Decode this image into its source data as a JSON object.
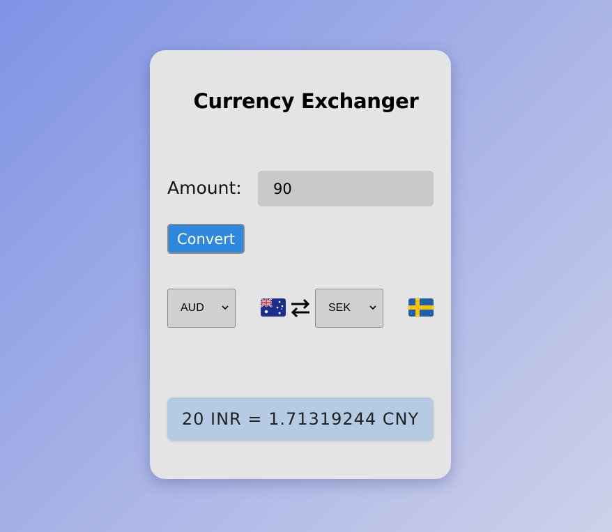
{
  "app": {
    "title": "Currency Exchanger"
  },
  "amount": {
    "label": "Amount:",
    "value": "90"
  },
  "convert_button": {
    "label": "Convert"
  },
  "from_currency": {
    "selected": "AUD",
    "flag": "australia-flag-icon"
  },
  "to_currency": {
    "selected": "SEK",
    "flag": "sweden-flag-icon"
  },
  "swap": {
    "icon": "swap-arrows-icon"
  },
  "result": {
    "text": "20 INR = 1.71319244 CNY"
  },
  "colors": {
    "button": "#2f88e0",
    "result_bg": "#b5cbe4",
    "card_bg": "#e4e4e4"
  }
}
